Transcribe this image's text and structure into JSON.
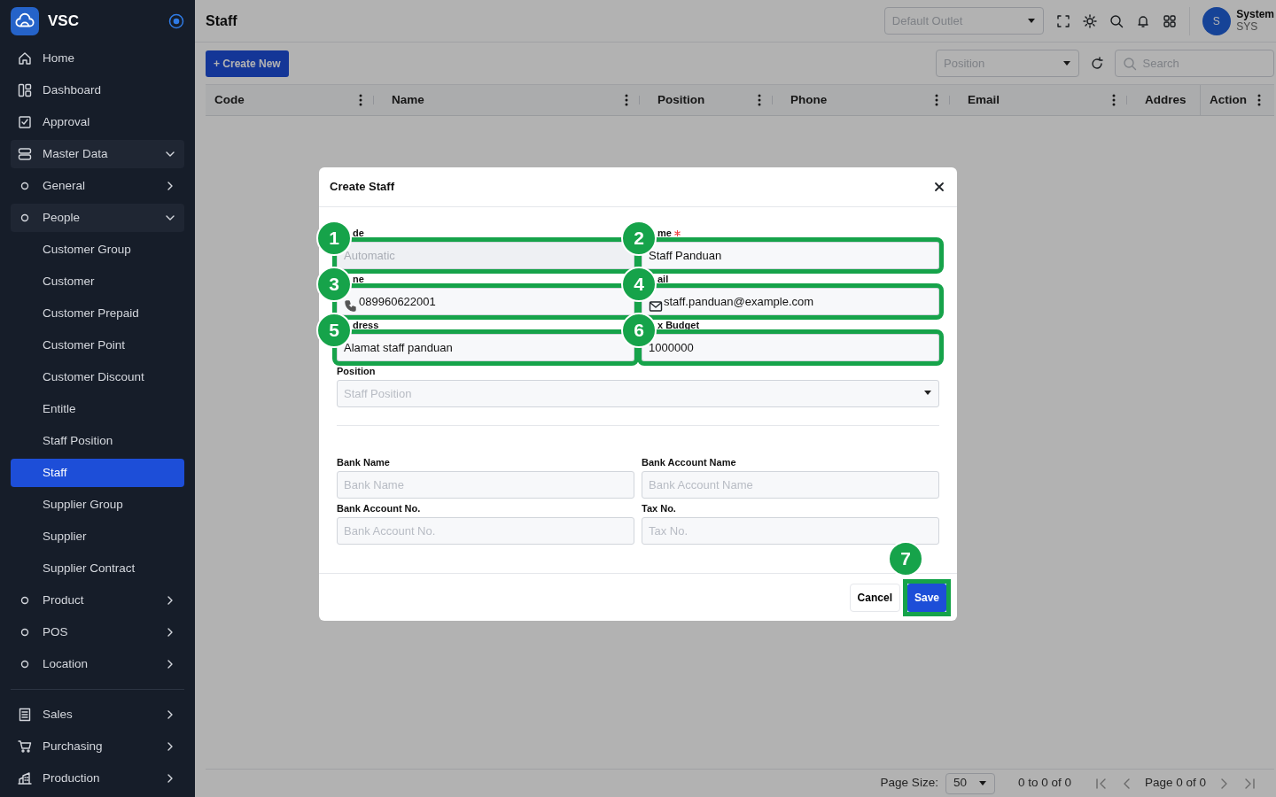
{
  "sidebar": {
    "brand": "VSC",
    "items": [
      {
        "label": "Home"
      },
      {
        "label": "Dashboard"
      },
      {
        "label": "Approval"
      },
      {
        "label": "Master Data",
        "expanded": true,
        "children": [
          {
            "label": "General",
            "expanded": false
          },
          {
            "label": "People",
            "expanded": true,
            "children": [
              {
                "label": "Customer Group",
                "selected": false
              },
              {
                "label": "Customer",
                "selected": false
              },
              {
                "label": "Customer Prepaid",
                "selected": false
              },
              {
                "label": "Customer Point",
                "selected": false
              },
              {
                "label": "Customer Discount",
                "selected": false
              },
              {
                "label": "Entitle",
                "selected": false
              },
              {
                "label": "Staff Position",
                "selected": false
              },
              {
                "label": "Staff",
                "selected": true
              },
              {
                "label": "Supplier Group",
                "selected": false
              },
              {
                "label": "Supplier",
                "selected": false
              },
              {
                "label": "Supplier Contract",
                "selected": false
              }
            ]
          },
          {
            "label": "Product",
            "expanded": false
          },
          {
            "label": "POS",
            "expanded": false
          },
          {
            "label": "Location",
            "expanded": false
          }
        ]
      },
      {
        "label": "Sales",
        "expanded": false
      },
      {
        "label": "Purchasing",
        "expanded": false
      },
      {
        "label": "Production",
        "expanded": false
      }
    ]
  },
  "header": {
    "title": "Staff",
    "outlet_placeholder": "Default Outlet",
    "user": {
      "initial": "S",
      "name": "System",
      "code": "SYS"
    }
  },
  "toolbar": {
    "create_button": "+ Create New",
    "position_placeholder": "Position",
    "search_placeholder": "Search"
  },
  "table": {
    "columns": [
      "Code",
      "Name",
      "Position",
      "Phone",
      "Email",
      "Addres",
      "Action"
    ]
  },
  "footer": {
    "page_size_label": "Page Size:",
    "page_size": "50",
    "range": "0 to 0 of 0",
    "page": "Page 0 of 0"
  },
  "modal": {
    "title": "Create Staff",
    "fields": [
      {
        "kind": "text",
        "label": "de",
        "placeholder": "Automatic",
        "disabled": true,
        "callout": "1"
      },
      {
        "kind": "text",
        "label": "me",
        "value": "Staff Panduan",
        "required": true,
        "callout": "2"
      },
      {
        "kind": "phone",
        "label": "ne",
        "value": "089960622001",
        "callout": "3"
      },
      {
        "kind": "email",
        "label": "ail",
        "value": "staff.panduan@example.com",
        "callout": "4"
      },
      {
        "kind": "text",
        "label": "dress",
        "value": "Alamat staff panduan",
        "callout": "5"
      },
      {
        "kind": "text",
        "label": "x Budget",
        "value": "1000000",
        "callout": "6"
      },
      {
        "kind": "select",
        "label": "Position",
        "placeholder": "Staff Position"
      }
    ],
    "bank_fields": [
      {
        "label": "Bank Name",
        "placeholder": "Bank Name"
      },
      {
        "label": "Bank Account Name",
        "placeholder": "Bank Account Name"
      },
      {
        "label": "Bank Account No.",
        "placeholder": "Bank Account No."
      },
      {
        "label": "Tax No.",
        "placeholder": "Tax No."
      }
    ],
    "cancel_button": "Cancel",
    "save_button": {
      "label": "Save",
      "callout": "7"
    }
  }
}
